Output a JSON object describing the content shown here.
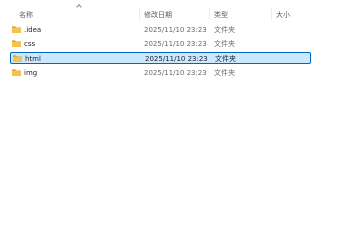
{
  "columns": {
    "name": "名称",
    "date_modified": "修改日期",
    "type": "类型",
    "size": "大小"
  },
  "colors": {
    "selected_bg": "#cce8ff",
    "selected_border": "#0067c0",
    "folder_yellow": "#f4c24f",
    "folder_back": "#e0a526"
  },
  "icons": {
    "folder": "folder-icon",
    "sort": "sort-ascending-icon"
  },
  "files": [
    {
      "name": ".idea",
      "date": "2025/11/10 23:23",
      "type": "文件夹"
    },
    {
      "name": "css",
      "date": "2025/11/10 23:23",
      "type": "文件夹"
    },
    {
      "name": "html",
      "date": "2025/11/10 23:23",
      "type": "文件夹",
      "selected": true
    },
    {
      "name": "img",
      "date": "2025/11/10 23:23",
      "type": "文件夹"
    }
  ]
}
